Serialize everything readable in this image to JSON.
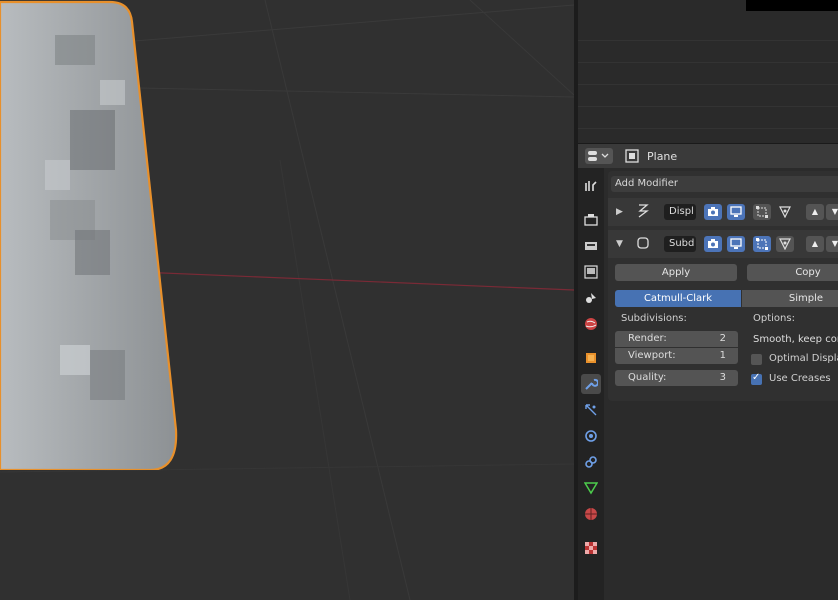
{
  "header": {
    "object_name": "Plane"
  },
  "modifiers": {
    "add_label": "Add Modifier",
    "items": [
      {
        "name": "Displ",
        "expanded": false
      },
      {
        "name": "Subd",
        "expanded": true
      }
    ],
    "apply_label": "Apply",
    "copy_label": "Copy",
    "algorithm": {
      "options": [
        "Catmull-Clark",
        "Simple"
      ],
      "selected": "Catmull-Clark"
    },
    "subdivisions_label": "Subdivisions:",
    "options_label": "Options:",
    "render": {
      "label": "Render:",
      "value": "2"
    },
    "viewport": {
      "label": "Viewport:",
      "value": "1"
    },
    "quality": {
      "label": "Quality:",
      "value": "3"
    },
    "uv_smooth": "Smooth, keep corners",
    "optimal_display": {
      "label": "Optimal Display",
      "checked": false
    },
    "use_creases": {
      "label": "Use Creases",
      "checked": true
    }
  },
  "colors": {
    "accent": "#4772b3",
    "selection_outline": "#e8902b",
    "x_axis": "#a03040"
  },
  "tabs": [
    "tool-icon",
    "render-icon",
    "output-icon",
    "view-layer-icon",
    "scene-icon",
    "world-icon",
    "object-icon",
    "wrench-icon",
    "particles-icon",
    "physics-icon",
    "constraints-icon",
    "data-icon",
    "material-icon",
    "texture-icon"
  ]
}
